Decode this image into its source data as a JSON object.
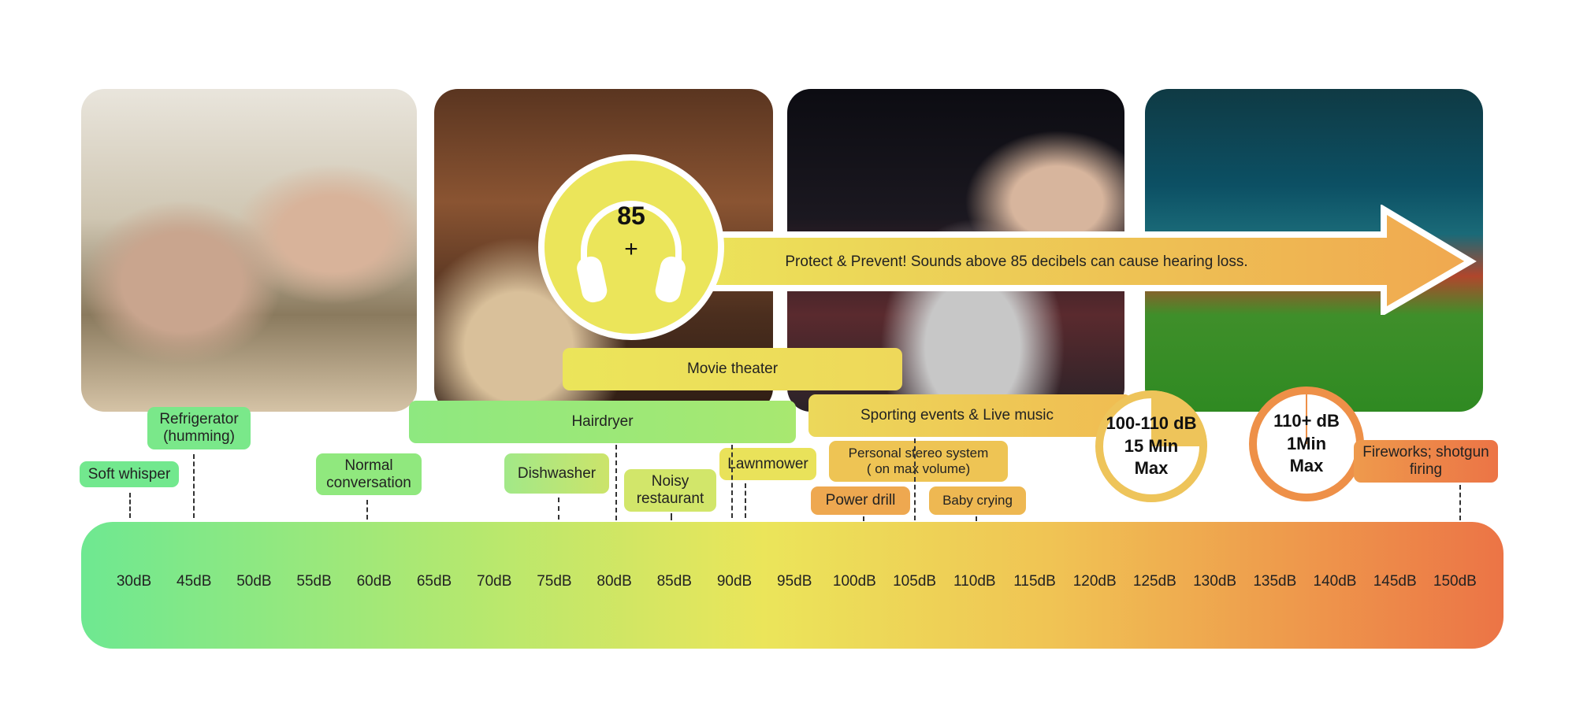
{
  "headline": {
    "badge_number": "85",
    "badge_plus": "+",
    "message": "Protect & Prevent! Sounds above 85 decibels can cause hearing loss.",
    "icon": "headphones-icon"
  },
  "scale": {
    "ticks": [
      "30dB",
      "45dB",
      "50dB",
      "55dB",
      "60dB",
      "65dB",
      "70dB",
      "75dB",
      "80dB",
      "85dB",
      "90dB",
      "95dB",
      "100dB",
      "105dB",
      "110dB",
      "115dB",
      "120dB",
      "125dB",
      "130dB",
      "135dB",
      "140dB",
      "145dB",
      "150dB"
    ],
    "colors": {
      "low": "#6ee891",
      "mid": "#ebe55a",
      "high": "#ec7446"
    }
  },
  "labels": {
    "soft_whisper": "Soft whisper",
    "refrigerator": "Refrigerator (humming)",
    "normal_conversation": "Normal conversation",
    "dishwasher": "Dishwasher",
    "noisy_restaurant": "Noisy restaurant",
    "hairdryer": "Hairdryer",
    "lawnmower": "Lawnmower",
    "movie_theater": "Movie theater",
    "sporting_events": "Sporting events & Live music",
    "personal_stereo_1": "Personal stereo system",
    "personal_stereo_2": "( on max volume)",
    "power_drill": "Power drill",
    "baby_crying": "Baby crying",
    "fireworks": "Fireworks; shotgun firing"
  },
  "limits": [
    {
      "level": "100-110 dB",
      "time": "15 Min",
      "suffix": "Max",
      "fraction_shown": 0.25
    },
    {
      "level": "110+ dB",
      "time": "1Min",
      "suffix": "Max"
    }
  ]
}
